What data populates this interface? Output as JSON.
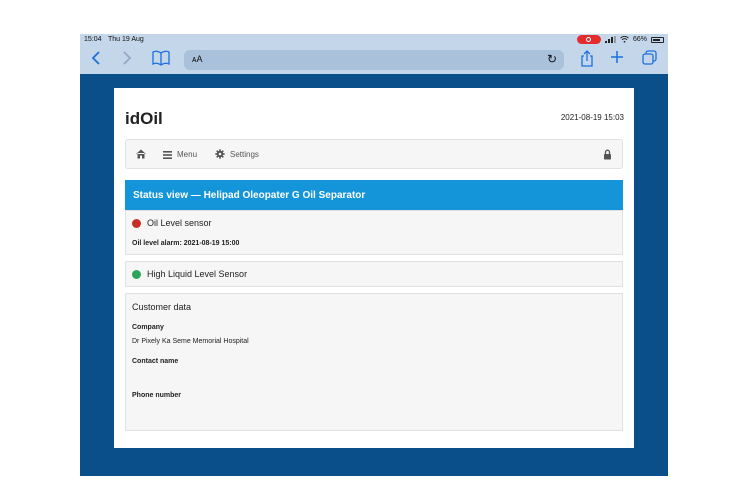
{
  "status_bar": {
    "time": "15:04",
    "date": "Thu 19 Aug",
    "battery": "66%"
  },
  "app": {
    "brand": "idOil",
    "datetime": "2021-08-19 15:03"
  },
  "navbar": {
    "menu_label": "Menu",
    "settings_label": "Settings"
  },
  "status_view": {
    "title": "Status view — Helipad Oleopater G Oil Separator"
  },
  "sensors": [
    {
      "label": "Oil Level sensor",
      "status_color": "#c62f27",
      "alarm": "Oil level alarm: 2021-08-19 15:00"
    },
    {
      "label": "High Liquid Level Sensor",
      "status_color": "#2aa55a"
    }
  ],
  "customer": {
    "title": "Customer data",
    "company_label": "Company",
    "company_value": "Dr Pixely Ka Seme Memorial Hospital",
    "contact_label": "Contact name",
    "contact_value": "",
    "phone_label": "Phone number",
    "phone_value": ""
  },
  "colors": {
    "frame_background": "#0b4f8a",
    "header_blue": "#1495d9",
    "safari_bar": "#c4d6e9",
    "safari_tint": "#1d6fe0"
  }
}
